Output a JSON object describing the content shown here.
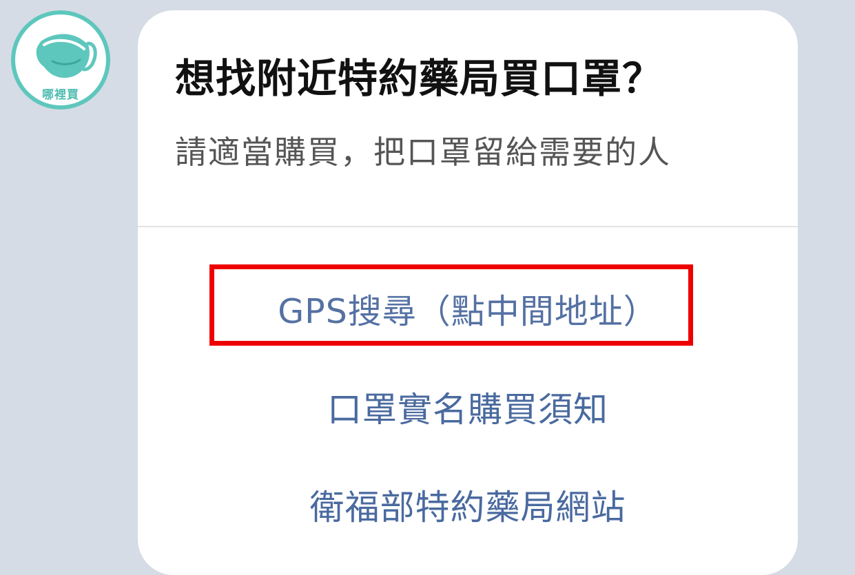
{
  "avatar": {
    "label": "哪裡買",
    "icon": "face-mask-icon",
    "ring_color": "#5ec7bd"
  },
  "card": {
    "title": "想找附近特約藥局買口罩？",
    "subtitle": "請適當購買，把口罩留給需要的人",
    "actions": [
      {
        "label": "GPS搜尋（點中間地址）",
        "highlighted": true
      },
      {
        "label": "口罩實名購買須知",
        "highlighted": false
      },
      {
        "label": "衛福部特約藥局網站",
        "highlighted": false
      }
    ]
  },
  "colors": {
    "background": "#d6dce5",
    "link": "#4a6a9f",
    "highlight_border": "#ee0000"
  }
}
